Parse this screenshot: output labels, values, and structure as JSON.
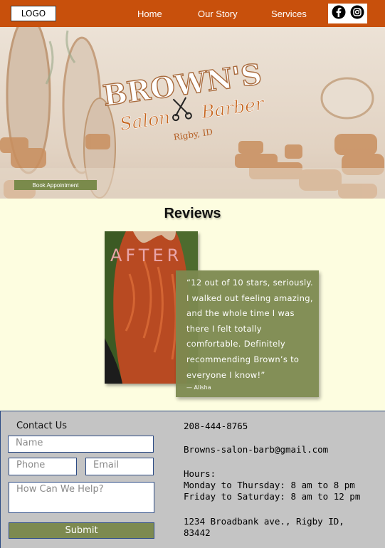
{
  "nav": {
    "logo": "LOGO",
    "links": [
      "Home",
      "Our Story",
      "Services"
    ],
    "social_icons": [
      "facebook-icon",
      "instagram-icon"
    ],
    "color": "#c8500c"
  },
  "hero": {
    "brand": "BROWN'S",
    "subtitle_left": "Salon",
    "subtitle_right": "Barber",
    "location": "Rigby, ID",
    "book_button": "Book Appointment"
  },
  "reviews": {
    "title": "Reviews",
    "photo_label": "AFTER",
    "quote": "“12 out of 10 stars, seriously. I walked out feeling amazing, and the whole time I was there I felt totally comfortable. Definitely recommending Brown’s to everyone I know!”",
    "author": "— Alisha"
  },
  "contact": {
    "heading": "Contact Us",
    "name_placeholder": "Name",
    "phone_placeholder": "Phone",
    "email_placeholder": "Email",
    "message_placeholder": "How Can We Help?",
    "submit_label": "Submit",
    "phone": "208-444-8765",
    "email": "Browns-salon-barb@gmail.com",
    "hours": "Hours:\nMonday to Thursday: 8 am to 8 pm\nFriday to Saturday: 8 am to 12 pm",
    "address": "1234 Broadbank ave., Rigby ID,\n83442"
  }
}
